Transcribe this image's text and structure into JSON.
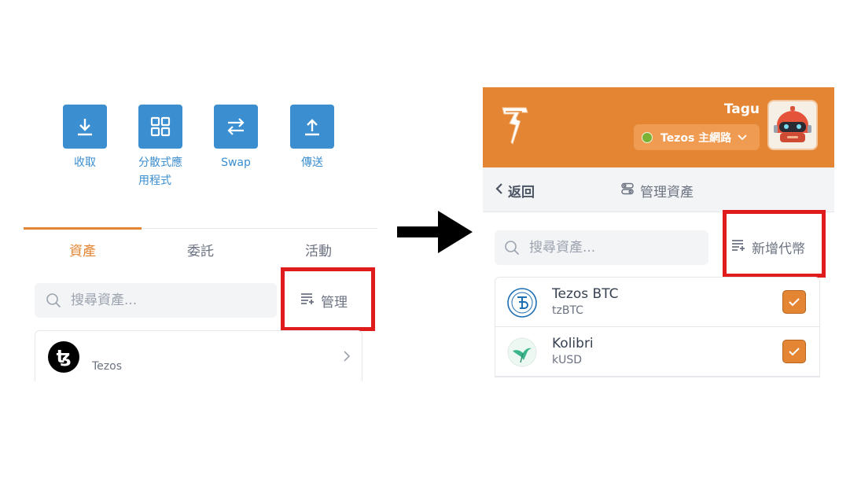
{
  "left": {
    "actions": [
      {
        "label": "收取",
        "icon": "download-icon"
      },
      {
        "label": "分散式應用程式",
        "icon": "grid-icon"
      },
      {
        "label": "Swap",
        "icon": "swap-icon"
      },
      {
        "label": "傳送",
        "icon": "upload-icon"
      }
    ],
    "tabs": [
      "資產",
      "委託",
      "活動"
    ],
    "search_placeholder": "搜尋資產...",
    "manage_label": "管理",
    "token": {
      "name": "Tezos",
      "logo_glyph": "ꜩ"
    }
  },
  "right": {
    "account_name": "Tagu",
    "network": "Tezos 主網路",
    "back_label": "返回",
    "page_title": "管理資產",
    "search_placeholder": "搜尋資產...",
    "add_token_label": "新增代幣",
    "tokens": [
      {
        "name": "Tezos BTC",
        "symbol": "tzBTC",
        "checked": true
      },
      {
        "name": "Kolibri",
        "symbol": "kUSD",
        "checked": true
      }
    ]
  },
  "colors": {
    "accent": "#e38532",
    "action_blue": "#3b8ed0",
    "highlight_red": "#e01b1b",
    "network_dot": "#7bb236"
  }
}
